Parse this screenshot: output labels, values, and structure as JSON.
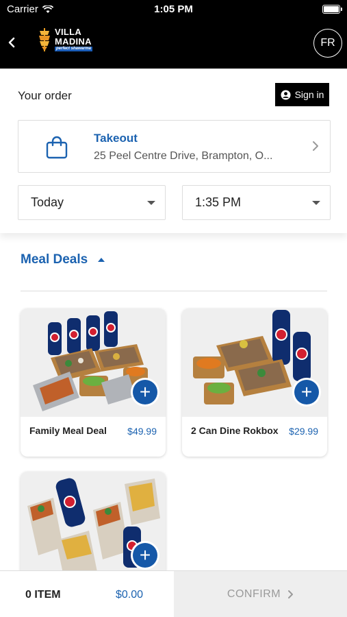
{
  "status_bar": {
    "carrier": "Carrier",
    "time": "1:05 PM"
  },
  "header": {
    "logo_line1": "VILLA",
    "logo_line2": "MADINA",
    "logo_tagline": "perfect shawarma",
    "language_button": "FR"
  },
  "order": {
    "title": "Your order",
    "sign_in_label": "Sign in",
    "mode_title": "Takeout",
    "address": "25 Peel Centre Drive, Brampton, O...",
    "day_select": "Today",
    "time_select": "1:35 PM"
  },
  "menu": {
    "category": "Meal Deals",
    "products": [
      {
        "name": "Family Meal Deal",
        "price": "$49.99"
      },
      {
        "name": "2 Can Dine Rokbox",
        "price": "$29.99"
      },
      {
        "name": "",
        "price": ""
      }
    ]
  },
  "cart": {
    "item_count": "0 ITEM",
    "total": "$0.00",
    "confirm_label": "CONFIRM"
  },
  "colors": {
    "accent": "#1b62b0",
    "add_button": "#1558a8",
    "header_bg": "#000000"
  }
}
